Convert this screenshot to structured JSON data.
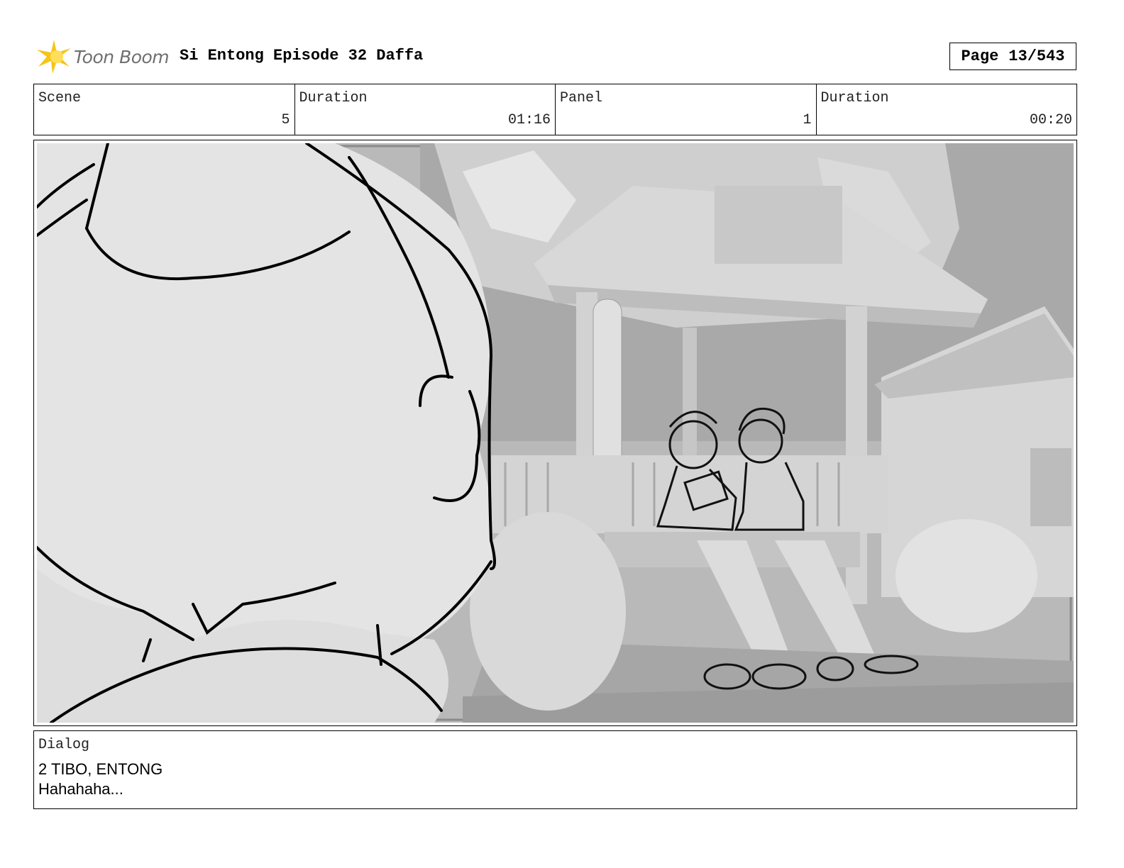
{
  "header": {
    "logo_text": "Toon Boom",
    "title": "Si Entong Episode 32 Daffa",
    "page_label": "Page",
    "page_value": "13/543"
  },
  "info": [
    {
      "label": "Scene",
      "value": "5"
    },
    {
      "label": "Duration",
      "value": "01:16"
    },
    {
      "label": "Panel",
      "value": "1"
    },
    {
      "label": "Duration",
      "value": "00:20"
    }
  ],
  "dialog": {
    "label": "Dialog",
    "lines": [
      "2 TIBO, ENTONG",
      "Hahahaha..."
    ]
  },
  "colors": {
    "logo_accent": "#f5c518",
    "border": "#000000"
  }
}
